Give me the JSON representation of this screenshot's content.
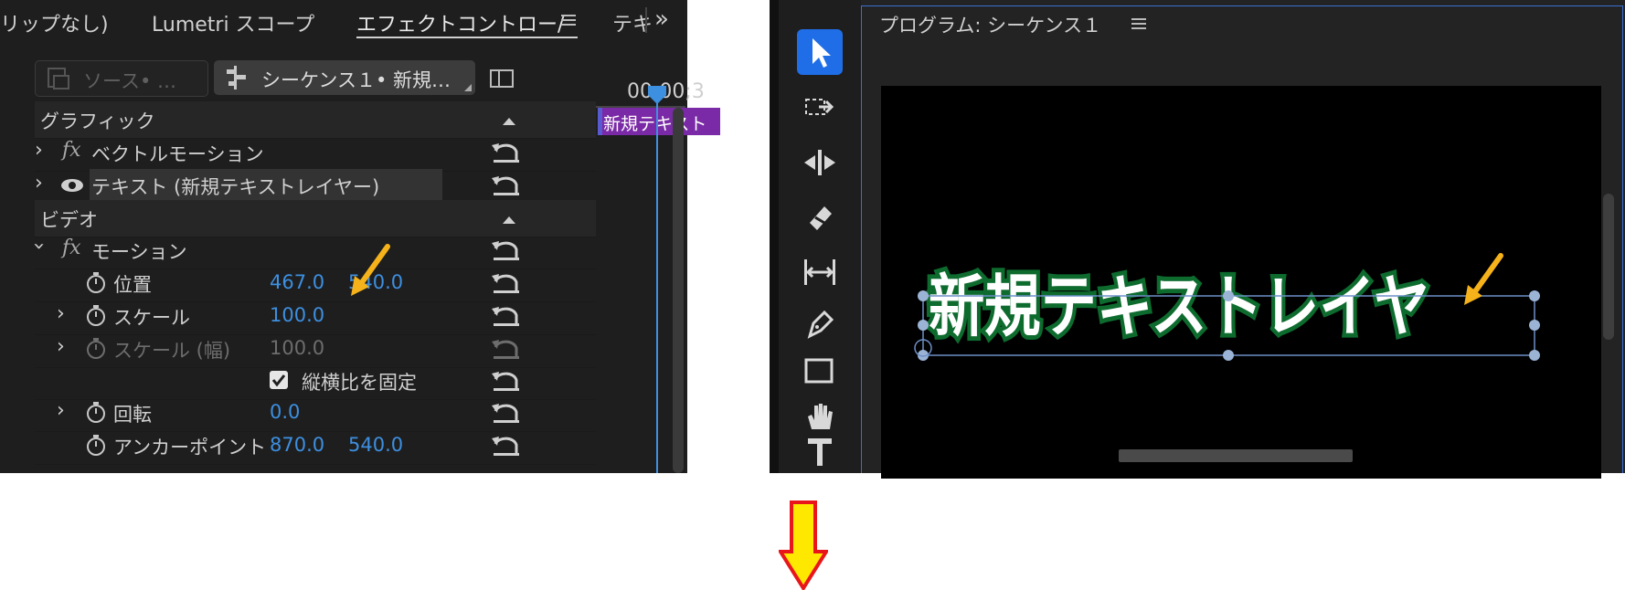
{
  "tabs": {
    "clip_tab": "リップなし)",
    "lumetri_tab": "Lumetri スコープ",
    "effect_tab": "エフェクトコントロー/",
    "text_tab": "テキ",
    "overflow": "»"
  },
  "source": {
    "source_dropdown": "ソース• …",
    "sequence_dropdown": "シーケンス１• 新規…"
  },
  "timeline": {
    "timecode": "00;00;3",
    "clip_label": "新規テキスト"
  },
  "sections": {
    "graphic": "グラフィック",
    "video": "ビデオ"
  },
  "graphic_rows": {
    "vector_motion": "ベクトルモーション",
    "text_layer": "テキスト (新規テキストレイヤー)"
  },
  "motion": {
    "label": "モーション",
    "position": {
      "label": "位置",
      "x": "467.0",
      "y": "540.0"
    },
    "scale": {
      "label": "スケール",
      "value": "100.0"
    },
    "scale_width": {
      "label": "スケール (幅)",
      "value": "100.0"
    },
    "uniform_scale": {
      "label": "縦横比を固定",
      "checked": true
    },
    "rotation": {
      "label": "回転",
      "value": "0.0"
    },
    "anchor": {
      "label": "アンカーポイント",
      "x": "870.0",
      "y": "540.0"
    }
  },
  "program": {
    "title": "プログラム: シーケンス１",
    "canvas_text": "新規テキストレイヤ"
  },
  "tools": [
    "selection-tool-icon",
    "track-select-icon",
    "ripple-edit-icon",
    "razor-icon",
    "slip-icon",
    "pen-icon",
    "rectangle-icon",
    "hand-icon",
    "type-icon"
  ],
  "colors": {
    "accent_blue": "#3d8fe0",
    "clip_purple": "#7a2aa6",
    "text_green": "#0d6b2e",
    "arrow_orange": "#f5b21a",
    "arrow_red": "#e8161b",
    "arrow_yellow": "#ffe800"
  }
}
